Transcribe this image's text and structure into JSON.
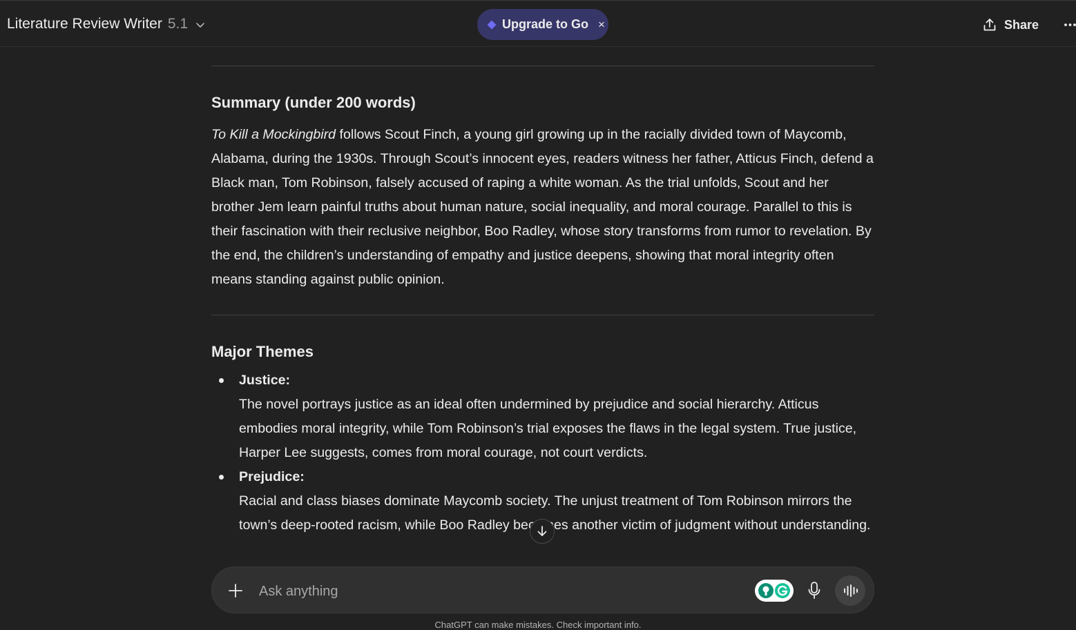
{
  "header": {
    "model_name": "Literature Review Writer",
    "model_version": "5.1",
    "upgrade_label": "Upgrade to Go",
    "upgrade_close": "×",
    "share_label": "Share"
  },
  "summary": {
    "heading": "Summary (under 200 words)",
    "book_title": "To Kill a Mockingbird",
    "text": " follows Scout Finch, a young girl growing up in the racially divided town of Maycomb, Alabama, during the 1930s. Through Scout’s innocent eyes, readers witness her father, Atticus Finch, defend a Black man, Tom Robinson, falsely accused of raping a white woman. As the trial unfolds, Scout and her brother Jem learn painful truths about human nature, social inequality, and moral courage. Parallel to this is their fascination with their reclusive neighbor, Boo Radley, whose story transforms from rumor to revelation. By the end, the children’s understanding of empathy and justice deepens, showing that moral integrity often means standing against public opinion."
  },
  "themes": {
    "heading": "Major Themes",
    "items": [
      {
        "title": "Justice:",
        "body": "The novel portrays justice as an ideal often undermined by prejudice and social hierarchy. Atticus embodies moral integrity, while Tom Robinson’s trial exposes the flaws in the legal system. True justice, Harper Lee suggests, comes from moral courage, not court verdicts."
      },
      {
        "title": "Prejudice:",
        "body": "Racial and class biases dominate Maycomb society. The unjust treatment of Tom Robinson mirrors the town’s deep-rooted racism, while Boo Radley becomes another victim of judgment without understanding."
      }
    ]
  },
  "composer": {
    "placeholder": "Ask anything"
  },
  "footer": {
    "disclaimer": "ChatGPT can make mistakes. Check important info."
  },
  "icons": {
    "chevron": "chevron-down-icon",
    "upgrade": "diamond-icon",
    "share": "share-icon",
    "more": "more-icon",
    "scroll": "arrow-down-icon",
    "plus": "plus-icon",
    "grammarly": "grammarly-icon",
    "mic": "mic-icon",
    "voice": "voice-mode-icon"
  },
  "colors": {
    "background": "#212121",
    "upgrade_pill": "#373669",
    "accent_diamond": "#6e6cf0",
    "grammarly_green": "#15c39a"
  }
}
